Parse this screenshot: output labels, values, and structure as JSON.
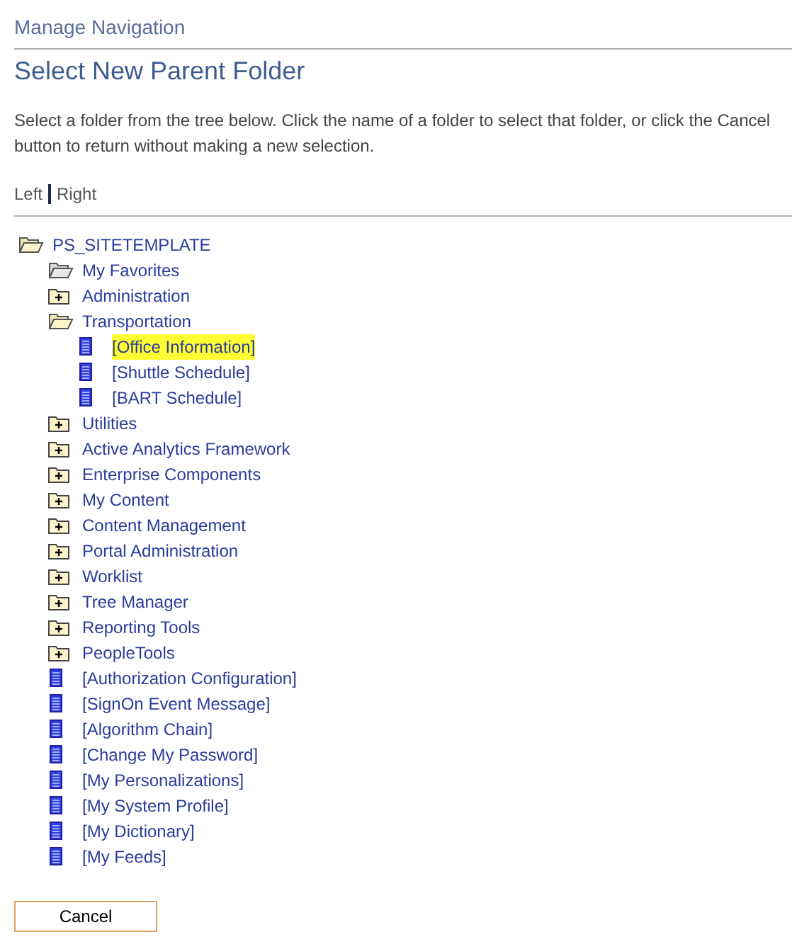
{
  "breadcrumb": "Manage Navigation",
  "title": "Select New Parent Folder",
  "instructions": "Select a folder from the tree below. Click the name of a folder to select that folder, or click the Cancel button to return without making a new selection.",
  "view_links": [
    {
      "label": "Left"
    },
    {
      "label": "Right"
    }
  ],
  "tree": {
    "label": "PS_SITETEMPLATE",
    "kind": "open-folder",
    "selected": false,
    "children": [
      {
        "label": "My Favorites",
        "kind": "empty-folder",
        "selected": false
      },
      {
        "label": "Administration",
        "kind": "closed-folder",
        "selected": false
      },
      {
        "label": "Transportation",
        "kind": "open-folder",
        "selected": false,
        "children": [
          {
            "label": "[Office Information]",
            "kind": "page",
            "selected": true
          },
          {
            "label": "[Shuttle Schedule]",
            "kind": "page",
            "selected": false
          },
          {
            "label": "[BART Schedule]",
            "kind": "page",
            "selected": false
          }
        ]
      },
      {
        "label": "Utilities",
        "kind": "closed-folder",
        "selected": false
      },
      {
        "label": "Active Analytics Framework",
        "kind": "closed-folder",
        "selected": false
      },
      {
        "label": "Enterprise Components",
        "kind": "closed-folder",
        "selected": false
      },
      {
        "label": "My Content",
        "kind": "closed-folder",
        "selected": false
      },
      {
        "label": "Content Management",
        "kind": "closed-folder",
        "selected": false
      },
      {
        "label": "Portal Administration",
        "kind": "closed-folder",
        "selected": false
      },
      {
        "label": "Worklist",
        "kind": "closed-folder",
        "selected": false
      },
      {
        "label": "Tree Manager",
        "kind": "closed-folder",
        "selected": false
      },
      {
        "label": "Reporting Tools",
        "kind": "closed-folder",
        "selected": false
      },
      {
        "label": "PeopleTools",
        "kind": "closed-folder",
        "selected": false
      },
      {
        "label": "[Authorization Configuration]",
        "kind": "page",
        "selected": false
      },
      {
        "label": "[SignOn Event Message]",
        "kind": "page",
        "selected": false
      },
      {
        "label": "[Algorithm Chain]",
        "kind": "page",
        "selected": false
      },
      {
        "label": "[Change My Password]",
        "kind": "page",
        "selected": false
      },
      {
        "label": "[My Personalizations]",
        "kind": "page",
        "selected": false
      },
      {
        "label": "[My System Profile]",
        "kind": "page",
        "selected": false
      },
      {
        "label": "[My Dictionary]",
        "kind": "page",
        "selected": false
      },
      {
        "label": "[My Feeds]",
        "kind": "page",
        "selected": false
      }
    ]
  },
  "cancel_button": "Cancel"
}
